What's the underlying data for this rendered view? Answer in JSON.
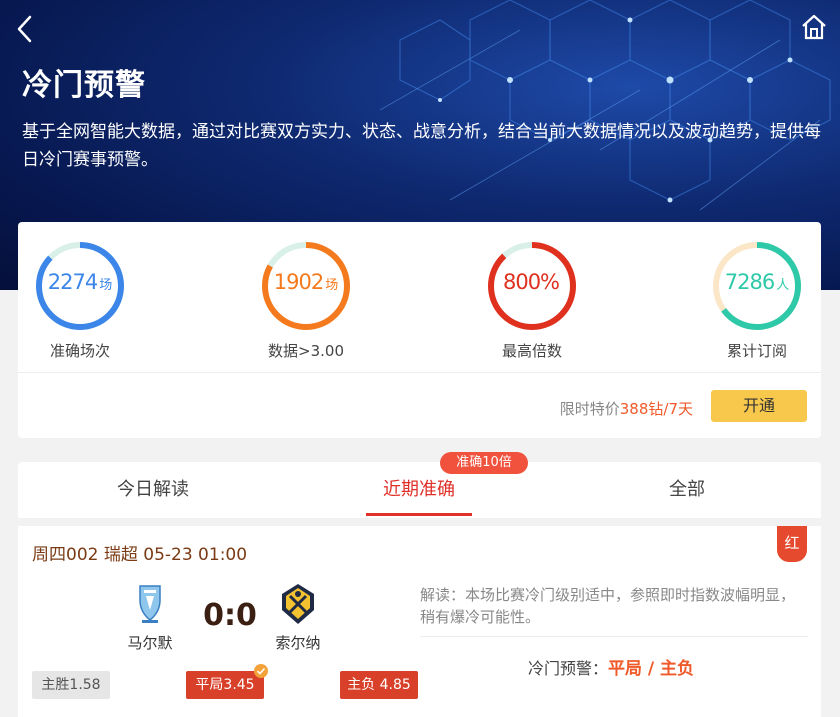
{
  "header": {
    "title": "冷门预警",
    "description": "基于全网智能大数据，通过对比赛双方实力、状态、战意分析，结合当前大数据情况以及波动趋势，提供每日冷门赛事预警。"
  },
  "stats": [
    {
      "value": "2274",
      "unit": "场",
      "label": "准确场次",
      "color": "#3b86e8",
      "progress": 0.87
    },
    {
      "value": "1902",
      "unit": "场",
      "label": "数据>3.00",
      "color": "#f57a1e",
      "progress": 0.83
    },
    {
      "value": "800%",
      "unit": "",
      "label": "最高倍数",
      "color": "#e0301e",
      "progress": 0.88
    },
    {
      "value": "7286",
      "unit": "人",
      "label": "累计订阅",
      "color": "#2ec9a8",
      "progress": 0.65
    }
  ],
  "promo": {
    "prefix": "限时特价",
    "price": "388钻/7天",
    "button": "开通"
  },
  "tabs": {
    "items": [
      "今日解读",
      "近期准确",
      "全部"
    ],
    "active_index": 1,
    "badge": "准确10倍"
  },
  "match": {
    "header": "周四002 瑞超 05-23 01:00",
    "result_badge": "红",
    "home_team": "马尔默",
    "away_team": "索尔纳",
    "score": "0:0",
    "odds": [
      {
        "label": "主胜1.58"
      },
      {
        "label": "平局3.45"
      },
      {
        "label": "主负 4.85"
      }
    ],
    "analysis": "解读：本场比赛冷门级别适中，参照即时指数波幅明显，稍有爆冷可能性。",
    "warning_label": "冷门预警：",
    "warning_pick": "平局 / 主负"
  }
}
